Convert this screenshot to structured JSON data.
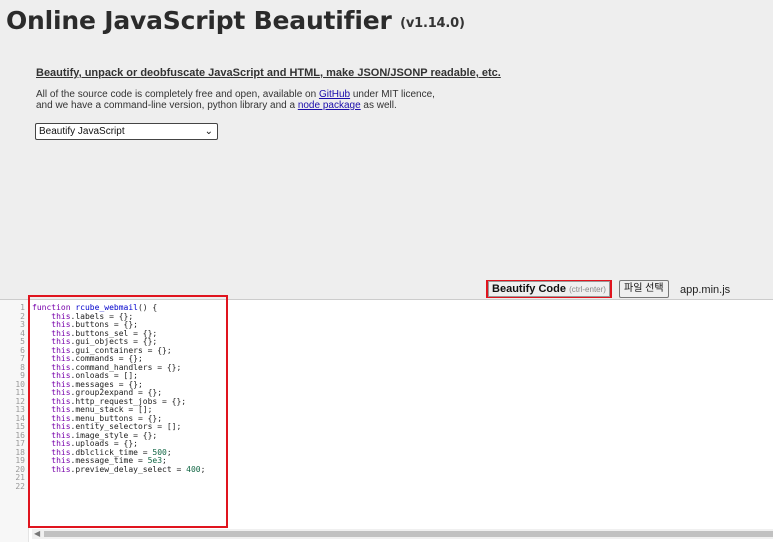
{
  "header": {
    "title": "Online JavaScript Beautifier",
    "version": "(v1.14.0)"
  },
  "intro": {
    "tagline": "Beautify, unpack or deobfuscate JavaScript and HTML, make JSON/JSONP readable, etc.",
    "line1_before": "All of the source code is completely free and open, available on ",
    "github_link": "GitHub",
    "line1_after": " under MIT licence,",
    "line2_before": "and we have a command-line version, python library and a ",
    "node_link": "node package",
    "line2_after": " as well."
  },
  "mode_select": {
    "value": "Beautify JavaScript"
  },
  "toolbar": {
    "beautify_label": "Beautify Code",
    "beautify_hint": "(ctrl-enter)",
    "file_button": "파일 선택",
    "file_name": "app.min.js"
  },
  "accent_colors": {
    "highlight": "#e0141e",
    "keyword": "#7700aa",
    "function_name": "#0000cc",
    "number": "#116644",
    "link": "#1a0dab"
  },
  "editor": {
    "line_numbers": [
      "1",
      "2",
      "3",
      "4",
      "5",
      "6",
      "7",
      "8",
      "9",
      "10",
      "11",
      "12",
      "13",
      "14",
      "15",
      "16",
      "17",
      "18",
      "19",
      "20",
      "21",
      "22"
    ],
    "lines": [
      {
        "indent": "",
        "kw": "function",
        "rest": " ",
        "fn": "rcube_webmail",
        "tail": "() {",
        "num": ""
      },
      {
        "indent": "    ",
        "kw": "this",
        "rest": ".labels = {};",
        "fn": "",
        "tail": "",
        "num": ""
      },
      {
        "indent": "    ",
        "kw": "this",
        "rest": ".buttons = {};",
        "fn": "",
        "tail": "",
        "num": ""
      },
      {
        "indent": "    ",
        "kw": "this",
        "rest": ".buttons_sel = {};",
        "fn": "",
        "tail": "",
        "num": ""
      },
      {
        "indent": "    ",
        "kw": "this",
        "rest": ".gui_objects = {};",
        "fn": "",
        "tail": "",
        "num": ""
      },
      {
        "indent": "    ",
        "kw": "this",
        "rest": ".gui_containers = {};",
        "fn": "",
        "tail": "",
        "num": ""
      },
      {
        "indent": "    ",
        "kw": "this",
        "rest": ".commands = {};",
        "fn": "",
        "tail": "",
        "num": ""
      },
      {
        "indent": "    ",
        "kw": "this",
        "rest": ".command_handlers = {};",
        "fn": "",
        "tail": "",
        "num": ""
      },
      {
        "indent": "    ",
        "kw": "this",
        "rest": ".onloads = [];",
        "fn": "",
        "tail": "",
        "num": ""
      },
      {
        "indent": "    ",
        "kw": "this",
        "rest": ".messages = {};",
        "fn": "",
        "tail": "",
        "num": ""
      },
      {
        "indent": "    ",
        "kw": "this",
        "rest": ".group2expand = {};",
        "fn": "",
        "tail": "",
        "num": ""
      },
      {
        "indent": "    ",
        "kw": "this",
        "rest": ".http_request_jobs = {};",
        "fn": "",
        "tail": "",
        "num": ""
      },
      {
        "indent": "    ",
        "kw": "this",
        "rest": ".menu_stack = [];",
        "fn": "",
        "tail": "",
        "num": ""
      },
      {
        "indent": "    ",
        "kw": "this",
        "rest": ".menu_buttons = {};",
        "fn": "",
        "tail": "",
        "num": ""
      },
      {
        "indent": "    ",
        "kw": "this",
        "rest": ".entity_selectors = [];",
        "fn": "",
        "tail": "",
        "num": ""
      },
      {
        "indent": "    ",
        "kw": "this",
        "rest": ".image_style = {};",
        "fn": "",
        "tail": "",
        "num": ""
      },
      {
        "indent": "    ",
        "kw": "this",
        "rest": ".uploads = {};",
        "fn": "",
        "tail": "",
        "num": ""
      },
      {
        "indent": "    ",
        "kw": "this",
        "rest": ".dblclick_time = ",
        "fn": "",
        "tail": ";",
        "num": "500"
      },
      {
        "indent": "    ",
        "kw": "this",
        "rest": ".message_time = ",
        "fn": "",
        "tail": ";",
        "num": "5e3"
      },
      {
        "indent": "    ",
        "kw": "this",
        "rest": ".preview_delay_select = ",
        "fn": "",
        "tail": ";",
        "num": "400"
      }
    ]
  }
}
